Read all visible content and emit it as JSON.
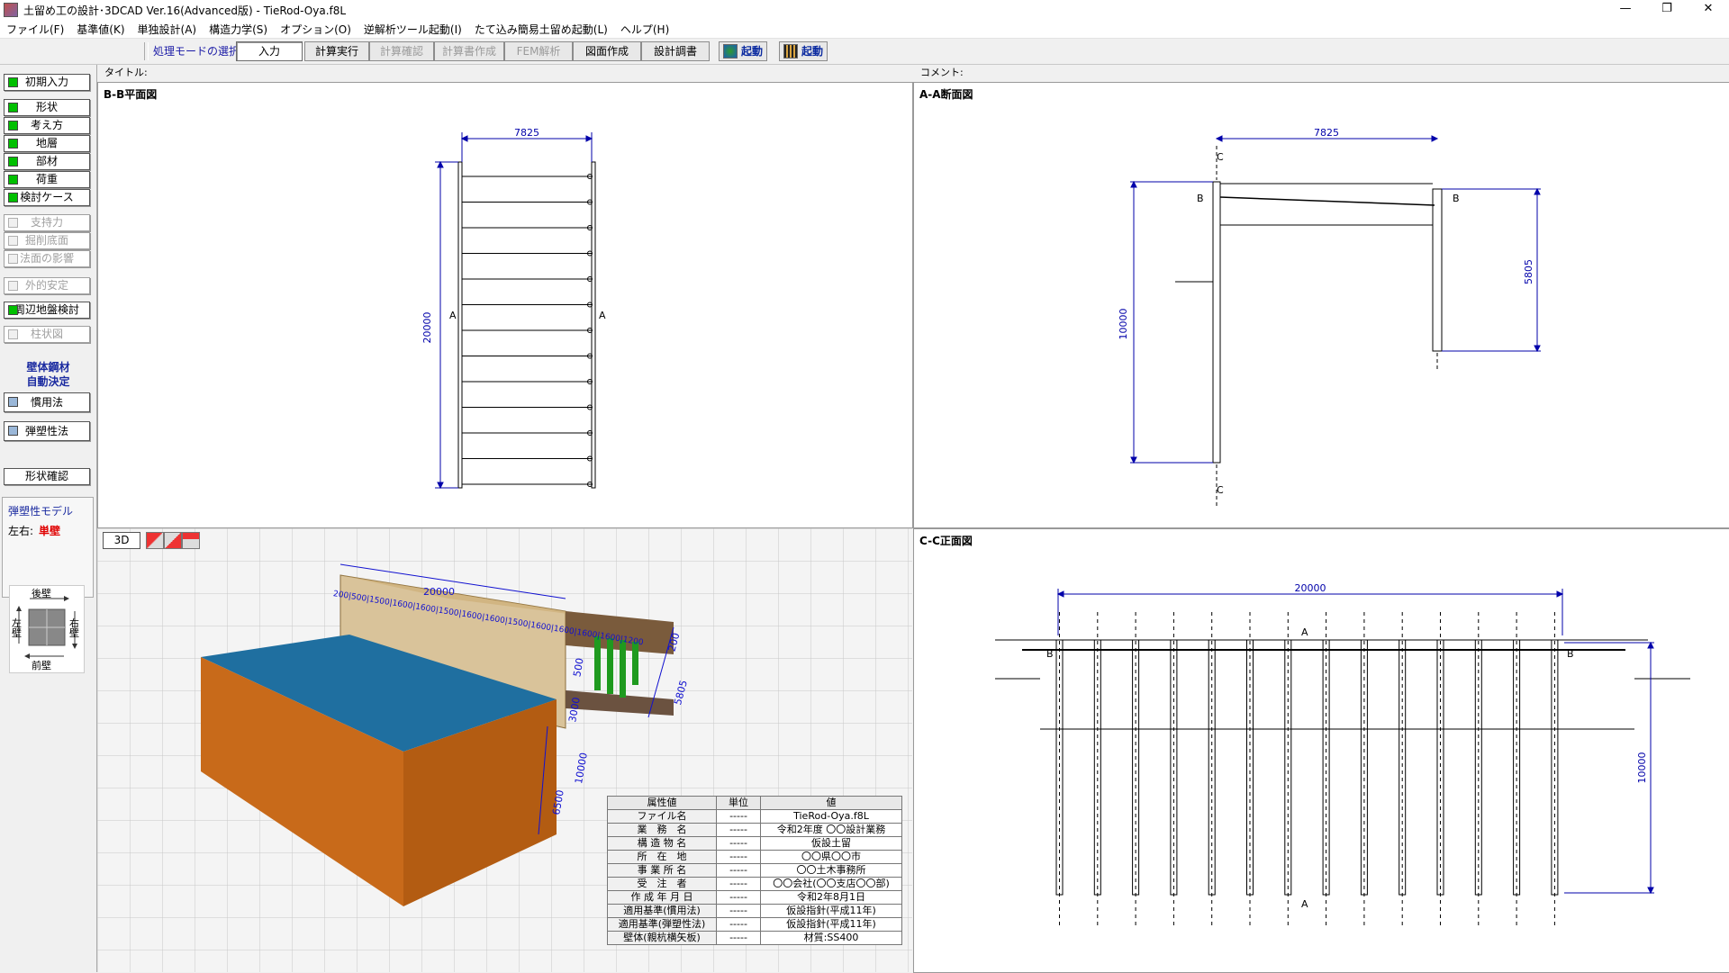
{
  "window": {
    "title": "土留め工の設計･3DCAD Ver.16(Advanced版) - TieRod-Oya.f8L",
    "controls": [
      "—",
      "❐",
      "✕"
    ]
  },
  "menu": [
    "ファイル(F)",
    "基準値(K)",
    "単独設計(A)",
    "構造力学(S)",
    "オプション(O)",
    "逆解析ツール起動(I)",
    "たて込み簡易土留め起動(L)",
    "ヘルプ(H)"
  ],
  "toolbar": {
    "mode_label": "処理モードの選択",
    "buttons": [
      "入力",
      "計算実行",
      "計算確認",
      "計算書作成",
      "FEM解析",
      "図面作成",
      "設計調書"
    ],
    "launch1": "起動",
    "launch2": "起動"
  },
  "left": {
    "initial": "初期入力",
    "group1": [
      "形状",
      "考え方",
      "地層",
      "部材",
      "荷重",
      "検討ケース"
    ],
    "group2": [
      "支持力",
      "掘削底面",
      "法面の影響"
    ],
    "external": "外的安定",
    "surround": "周辺地盤検討",
    "pillar": "柱状図",
    "auto_title1": "壁体鋼材",
    "auto_title2": "自動決定",
    "method1": "慣用法",
    "method2": "弾塑性法",
    "shape_check": "形状確認",
    "model_label": "弾塑性モデル",
    "lr_label": "左右:",
    "lr_value": "単壁",
    "compass": {
      "back": "後壁",
      "front": "前壁",
      "left": "左\n壁",
      "right": "右\n壁"
    }
  },
  "heads": {
    "title_label": "タイトル:",
    "comment_label": "コメント:"
  },
  "plan": {
    "title": "B-B平面図",
    "dim_w": "7825",
    "dim_h": "20000",
    "mark": "A"
  },
  "section": {
    "title": "A-A断面図",
    "dim_w": "7825",
    "dim_h1": "10000",
    "dim_h2": "5805",
    "mark_b": "B",
    "mark_c": "C"
  },
  "front": {
    "title": "C-C正面図",
    "dim_w": "20000",
    "dim_h": "10000",
    "mark_a": "A",
    "mark_b": "B"
  },
  "view3d": {
    "btn": "3D",
    "dims": [
      "20000",
      "200",
      "500",
      "5805",
      "3000",
      "10000",
      "6500"
    ],
    "spacing": "200|500|1500|1600|1600|1500|1600|1600|1500|1600|1600|1600|1600|1200"
  },
  "props": {
    "headers": [
      "属性値",
      "単位",
      "値"
    ],
    "rows": [
      [
        "ファイル名",
        "-----",
        "TieRod-Oya.f8L"
      ],
      [
        "業　務　名",
        "-----",
        "令和2年度 〇〇設計業務"
      ],
      [
        "構 造 物 名",
        "-----",
        "仮設土留"
      ],
      [
        "所　在　地",
        "-----",
        "〇〇県〇〇市"
      ],
      [
        "事 業 所 名",
        "-----",
        "〇〇土木事務所"
      ],
      [
        "受　注　者",
        "-----",
        "〇〇会社(〇〇支店〇〇部)"
      ],
      [
        "作 成 年 月 日",
        "-----",
        "令和2年8月1日"
      ],
      [
        "適用基準(慣用法)",
        "-----",
        "仮設指針(平成11年)"
      ],
      [
        "適用基準(弾塑性法)",
        "-----",
        "仮設指針(平成11年)"
      ],
      [
        "壁体(親杭横矢板)",
        "-----",
        "材質:SS400"
      ]
    ]
  }
}
